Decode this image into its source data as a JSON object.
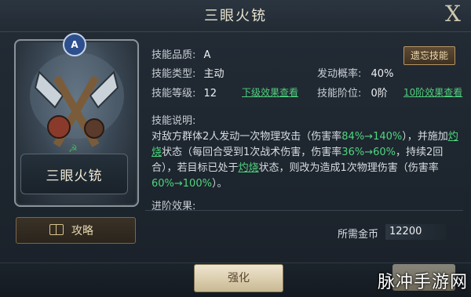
{
  "window": {
    "title": "三眼火铳",
    "close_label": "X"
  },
  "card": {
    "name": "三眼火铳",
    "rank_badge": "A",
    "faction_icon": "sickle-icon",
    "guide_button": "攻略"
  },
  "details": {
    "quality_label": "技能品质:",
    "quality_value": "A",
    "forget_button": "遗忘技能",
    "type_label": "技能类型:",
    "type_value": "主动",
    "prob_label": "发动概率:",
    "prob_value": "40%",
    "level_label": "技能等级:",
    "level_value": "12",
    "next_level_link": "下级效果查看",
    "tier_label": "技能阶位:",
    "tier_value": "0阶",
    "tier10_link": "10阶效果查看",
    "desc_label": "技能说明:",
    "desc": {
      "p1": "对敌方群体2人发动一次物理攻击（伤害率",
      "g1": "84%→140%",
      "p2": "），并施加",
      "u1": "灼烧",
      "p3": "状态（每回合受到1次战术伤害，伤害率",
      "g2": "36%→60%",
      "p4": "，持续2回合），若目标已处于",
      "u2": "灼烧",
      "p5": "状态，则改为造成1次物理伤害（伤害率",
      "g3": "60%→100%",
      "p6": "）。"
    },
    "advance_label": "进阶效果:",
    "gold_label": "所需金币",
    "gold_value": "12200"
  },
  "footer": {
    "strengthen_button": "强化"
  },
  "watermark": "脉冲手游网",
  "colors": {
    "highlight_green": "#4fd67e",
    "accent_gold": "#e6d6ae"
  }
}
